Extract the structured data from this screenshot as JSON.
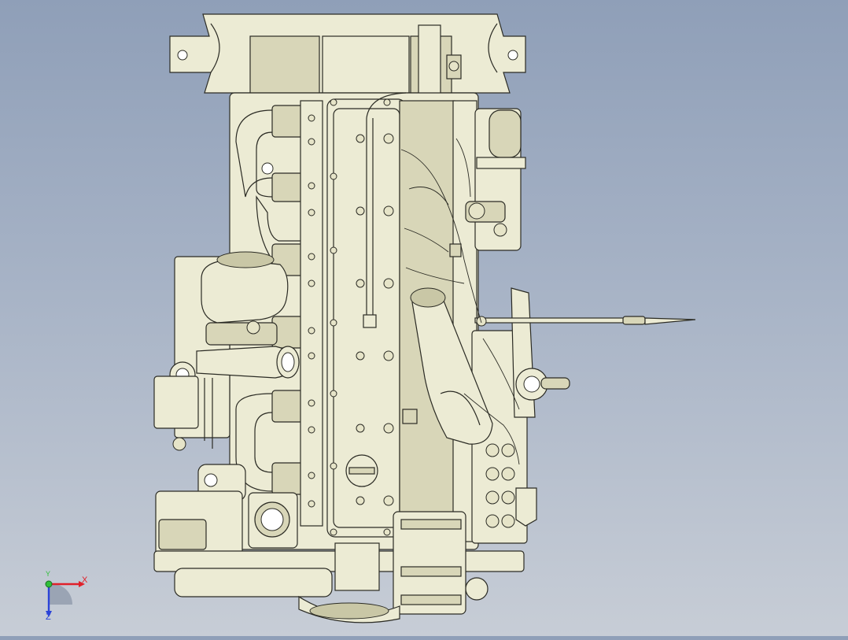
{
  "triad": {
    "x_label": "X",
    "y_label": "Y",
    "z_label": "Z",
    "x_color": "#e0202a",
    "y_color": "#2fbf3a",
    "z_color": "#2b43d8"
  },
  "colors": {
    "background_top": "#8f9fb8",
    "background_bottom": "#c7cdd6",
    "part_fill": "#ecebd4",
    "edge": "#2b2b24"
  }
}
